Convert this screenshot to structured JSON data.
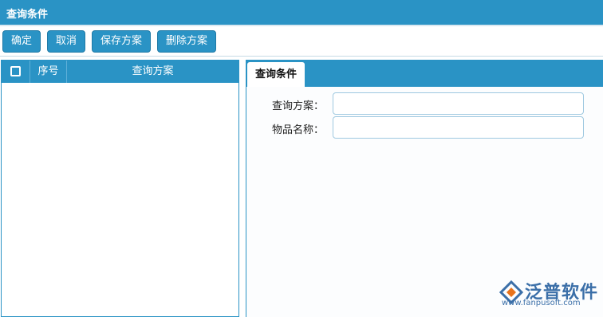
{
  "window": {
    "title": "查询条件"
  },
  "toolbar": {
    "confirm_label": "确定",
    "cancel_label": "取消",
    "save_plan_label": "保存方案",
    "delete_plan_label": "删除方案"
  },
  "grid": {
    "columns": {
      "seq": "序号",
      "plan": "查询方案"
    },
    "rows": []
  },
  "form": {
    "tab_label": "查询条件",
    "fields": [
      {
        "label": "查询方案：",
        "value": ""
      },
      {
        "label": "物品名称：",
        "value": ""
      }
    ]
  },
  "logo": {
    "name": "泛普软件",
    "url": "www.fanpusoft.com",
    "colors": {
      "primary": "#3b6fa8",
      "accent": "#e8731c"
    }
  },
  "colors": {
    "header": "#2a93c5",
    "input_border": "#9ec8e0"
  }
}
